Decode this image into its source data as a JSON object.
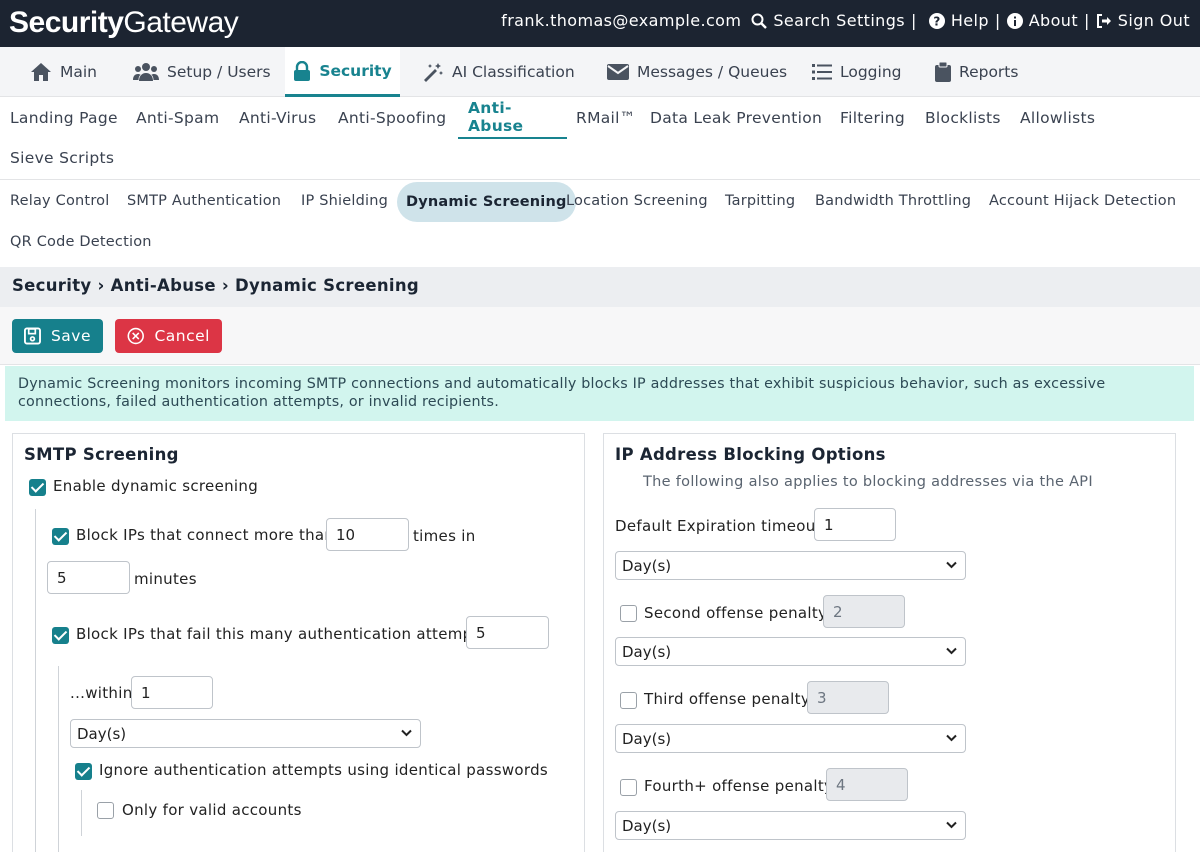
{
  "brand": {
    "part1": "Security",
    "part2": "Gateway"
  },
  "top": {
    "user": "frank.thomas@example.com",
    "search": "Search Settings",
    "help": "Help",
    "about": "About",
    "signout": "Sign Out",
    "sep": "|"
  },
  "mainnav": [
    {
      "label": "Main",
      "icon": "home-icon"
    },
    {
      "label": "Setup / Users",
      "icon": "users-icon"
    },
    {
      "label": "Security",
      "icon": "lock-icon"
    },
    {
      "label": "AI Classification",
      "icon": "magic-wand-icon"
    },
    {
      "label": "Messages / Queues",
      "icon": "envelope-icon"
    },
    {
      "label": "Logging",
      "icon": "list-icon"
    },
    {
      "label": "Reports",
      "icon": "clipboard-icon"
    }
  ],
  "subnav": [
    "Landing Page",
    "Anti-Spam",
    "Anti-Virus",
    "Anti-Spoofing",
    "Anti-Abuse",
    "RMail™",
    "Data Leak Prevention",
    "Filtering",
    "Blocklists",
    "Allowlists",
    "Sieve Scripts"
  ],
  "thirdnav": [
    "Relay Control",
    "SMTP Authentication",
    "IP Shielding",
    "Dynamic Screening",
    "Location Screening",
    "Tarpitting",
    "Bandwidth Throttling",
    "Account Hijack Detection",
    "QR Code Detection"
  ],
  "breadcrumb": "Security › Anti-Abuse › Dynamic Screening",
  "buttons": {
    "save": "Save",
    "cancel": "Cancel"
  },
  "info": "Dynamic Screening monitors incoming SMTP connections and automatically blocks IP addresses that exhibit suspicious behavior, such as excessive connections, failed authentication attempts, or invalid recipients.",
  "smtp": {
    "title": "SMTP Screening",
    "enable": {
      "label": "Enable dynamic screening",
      "checked": true
    },
    "connect": {
      "label": "Block IPs that connect more than",
      "checked": true,
      "value": "10",
      "suffix": "times in",
      "minutes_value": "5",
      "minutes_label": "minutes"
    },
    "auth": {
      "label": "Block IPs that fail this many authentication attempts",
      "checked": true,
      "value": "5",
      "within_label": "...within",
      "within_value": "1",
      "unit": "Day(s)"
    },
    "ignore": {
      "label": "Ignore authentication attempts using identical passwords",
      "checked": true
    },
    "valid": {
      "label": "Only for valid accounts",
      "checked": false
    }
  },
  "ipblock": {
    "title": "IP Address Blocking Options",
    "subtitle": "The following also applies to blocking addresses via the API",
    "default": {
      "label": "Default Expiration timeout",
      "value": "1",
      "unit": "Day(s)"
    },
    "second": {
      "label": "Second offense penalty",
      "value": "2",
      "unit": "Day(s)",
      "checked": false
    },
    "third": {
      "label": "Third offense penalty",
      "value": "3",
      "unit": "Day(s)",
      "checked": false
    },
    "fourth": {
      "label": "Fourth+ offense penalty",
      "value": "4",
      "unit": "Day(s)",
      "checked": false
    }
  },
  "colors": {
    "accent": "#16808c",
    "danger": "#dc3545",
    "topbar": "#1c2431",
    "info_bg": "#d2f5ee"
  }
}
